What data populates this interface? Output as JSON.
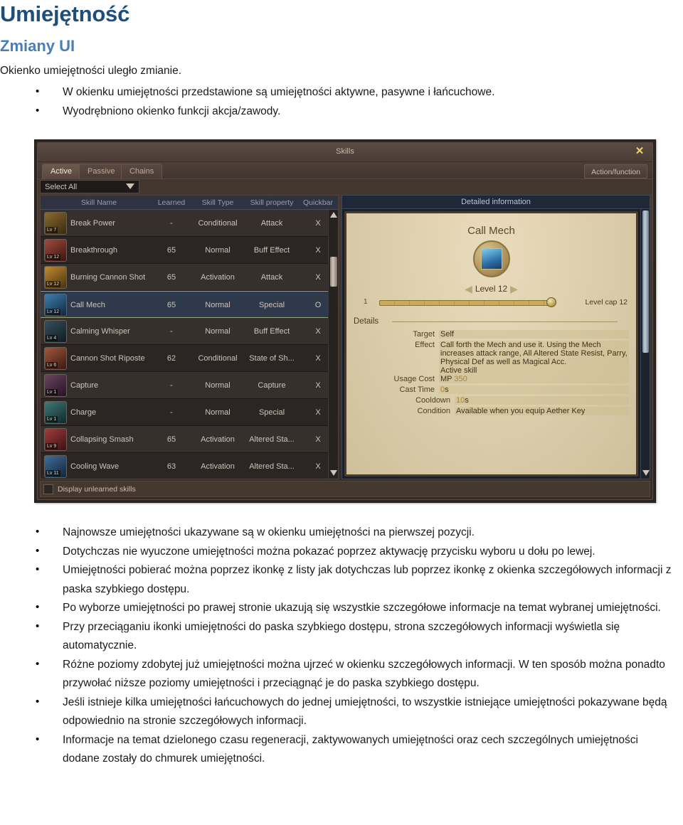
{
  "document": {
    "h1": "Umiejętność",
    "h2": "Zmiany UI",
    "intro": "Okienko umiejętności uległo zmianie.",
    "bullets_top": [
      "W okienku umiejętności przedstawione są umiejętności aktywne, pasywne i łańcuchowe.",
      "Wyodrębniono okienko funkcji akcja/zawody."
    ],
    "bullets_bottom": [
      "Najnowsze umiejętności ukazywane są w okienku umiejętności na pierwszej pozycji.",
      "Dotychczas nie wyuczone umiejętności można pokazać poprzez aktywację przycisku wyboru u dołu po lewej.",
      "Umiejętności pobierać można poprzez ikonkę z listy jak dotychczas lub poprzez ikonkę z okienka szczegółowych informacji z paska szybkiego dostępu.",
      "Po wyborze umiejętności po prawej stronie ukazują się wszystkie szczegółowe informacje na temat wybranej umiejętności.",
      "Przy przeciąganiu ikonki umiejętności do paska szybkiego dostępu, strona szczegółowych informacji wyświetla się automatycznie.",
      "Różne poziomy zdobytej już umiejętności można ujrzeć w okienku szczegółowych informacji. W ten sposób można ponadto przywołać niższe poziomy umiejętności i przeciągnąć je do paska szybkiego dostępu.",
      "Jeśli istnieje kilka umiejętności łańcuchowych do jednej umiejętności, to wszystkie istniejące umiejętności pokazywane będą odpowiednio na stronie szczegółowych informacji.",
      "Informacje na temat dzielonego czasu regeneracji, zaktywowanych umiejętności oraz cech szczególnych umiejętności dodane zostały do chmurek umiejętności."
    ],
    "colors": {
      "h1": "#1F4E79",
      "h2": "#4A7EBB",
      "body": "#1a1a1a"
    }
  },
  "game_window": {
    "title": "Skills",
    "close_icon": "✕",
    "tabs": [
      {
        "label": "Active",
        "active": true
      },
      {
        "label": "Passive",
        "active": false
      },
      {
        "label": "Chains",
        "active": false
      }
    ],
    "action_function_button": "Action/function",
    "filter_dropdown": {
      "value": "Select All",
      "caret_icon": "chevron-down-icon"
    },
    "table": {
      "headers": [
        "Skill Name",
        "Learned",
        "Skill Type",
        "Skill property",
        "Quickbar"
      ],
      "rows": [
        {
          "icon_level": "Lv 7",
          "name": "Break Power",
          "learned": "-",
          "type": "Conditional",
          "property": "Attack",
          "quickbar": "X",
          "selected": false,
          "icon_from": "#8a6a2e",
          "icon_to": "#3a2a12"
        },
        {
          "icon_level": "Lv 12",
          "name": "Breakthrough",
          "learned": "65",
          "type": "Normal",
          "property": "Buff Effect",
          "quickbar": "X",
          "selected": false,
          "icon_from": "#a04a3c",
          "icon_to": "#3a1612"
        },
        {
          "icon_level": "Lv 12",
          "name": "Burning Cannon Shot",
          "learned": "65",
          "type": "Activation",
          "property": "Attack",
          "quickbar": "X",
          "selected": false,
          "icon_from": "#c08a30",
          "icon_to": "#4a3310"
        },
        {
          "icon_level": "Lv 12",
          "name": "Call Mech",
          "learned": "65",
          "type": "Normal",
          "property": "Special",
          "quickbar": "O",
          "selected": true,
          "icon_from": "#3d7fae",
          "icon_to": "#10283e"
        },
        {
          "icon_level": "Lv 4",
          "name": "Calming Whisper",
          "learned": "-",
          "type": "Normal",
          "property": "Buff Effect",
          "quickbar": "X",
          "selected": false,
          "icon_from": "#34505c",
          "icon_to": "#111c22"
        },
        {
          "icon_level": "Lv 6",
          "name": "Cannon Shot Riposte",
          "learned": "62",
          "type": "Conditional",
          "property": "State of Sh...",
          "quickbar": "X",
          "selected": false,
          "icon_from": "#a5563d",
          "icon_to": "#3a1a10"
        },
        {
          "icon_level": "Lv 1",
          "name": "Capture",
          "learned": "-",
          "type": "Normal",
          "property": "Capture",
          "quickbar": "X",
          "selected": false,
          "icon_from": "#6b4560",
          "icon_to": "#241322"
        },
        {
          "icon_level": "Lv 1",
          "name": "Charge",
          "learned": "-",
          "type": "Normal",
          "property": "Special",
          "quickbar": "X",
          "selected": false,
          "icon_from": "#3f7a77",
          "icon_to": "#12282a"
        },
        {
          "icon_level": "Lv 9",
          "name": "Collapsing Smash",
          "learned": "65",
          "type": "Activation",
          "property": "Altered Sta...",
          "quickbar": "X",
          "selected": false,
          "icon_from": "#a33c3c",
          "icon_to": "#3a1212"
        },
        {
          "icon_level": "Lv 11",
          "name": "Cooling Wave",
          "learned": "63",
          "type": "Activation",
          "property": "Altered Sta...",
          "quickbar": "X",
          "selected": false,
          "icon_from": "#3f6e9a",
          "icon_to": "#122538"
        }
      ]
    },
    "display_unlearned": {
      "label": "Display unlearned skills",
      "checked": false
    },
    "detail_panel": {
      "header": "Detailed information",
      "skill_name": "Call Mech",
      "level_label": "Level 12",
      "prev_icon": "chevron-left-icon",
      "next_icon": "chevron-right-icon",
      "slider_min": "1",
      "slider_cap": "Level cap 12",
      "details_title": "Details",
      "fields": [
        {
          "key": "Target",
          "value": "Self"
        },
        {
          "key": "Effect",
          "value": "Call forth the Mech and use it. Using the Mech increases attack range, All Altered State Resist, Parry, Physical Def as well as Magical Acc.\nActive skill"
        },
        {
          "key": "Usage Cost",
          "value": "MP",
          "amber": "350"
        },
        {
          "key": "Cast Time",
          "value": "",
          "amber": "0",
          "suffix": "s"
        },
        {
          "key": "Cooldown",
          "value": "",
          "amber": "10",
          "suffix": "s",
          "indent": true
        },
        {
          "key": "Condition",
          "value": "Available when you equip Aether Key",
          "indent": true
        }
      ]
    }
  }
}
